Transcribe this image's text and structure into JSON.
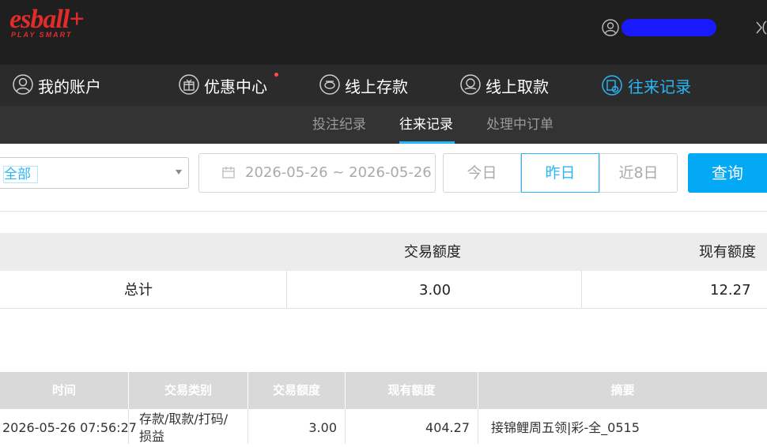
{
  "brand": {
    "name": "esball+",
    "tagline": "PLAY SMART"
  },
  "nav": {
    "items": [
      {
        "label": "我的账户",
        "icon": "user-icon"
      },
      {
        "label": "优惠中心",
        "icon": "gift-icon"
      },
      {
        "label": "线上存款",
        "icon": "deposit-icon"
      },
      {
        "label": "线上取款",
        "icon": "withdraw-icon"
      },
      {
        "label": "往来记录",
        "icon": "records-icon"
      }
    ],
    "active": "往来记录"
  },
  "subnav": {
    "items": [
      "投注纪录",
      "往来记录",
      "处理中订单"
    ],
    "active": "往来记录"
  },
  "filter": {
    "type_value": "全部",
    "date_range": "2026-05-26 ~ 2026-05-26",
    "quick": [
      "今日",
      "昨日",
      "近8日"
    ],
    "quick_active": "昨日",
    "query_label": "查询"
  },
  "summary": {
    "headers": [
      "交易额度",
      "现有额度"
    ],
    "row": {
      "label": "总计",
      "amount": "3.00",
      "balance": "12.27"
    }
  },
  "detail": {
    "headers": [
      "时间",
      "交易类别",
      "交易额度",
      "现有额度",
      "摘要"
    ],
    "rows": [
      {
        "time": "2026-05-26 07:56:27",
        "category_line1": "存款/取款/打码/",
        "category_line2": "损益",
        "amount": "3.00",
        "balance": "404.27",
        "memo": "接锦鲤周五领|彩-全_0515"
      }
    ]
  },
  "colors": {
    "accent": "#29b6f6",
    "brand_red": "#e32b2b",
    "header_bg": "#1f1f1f"
  }
}
